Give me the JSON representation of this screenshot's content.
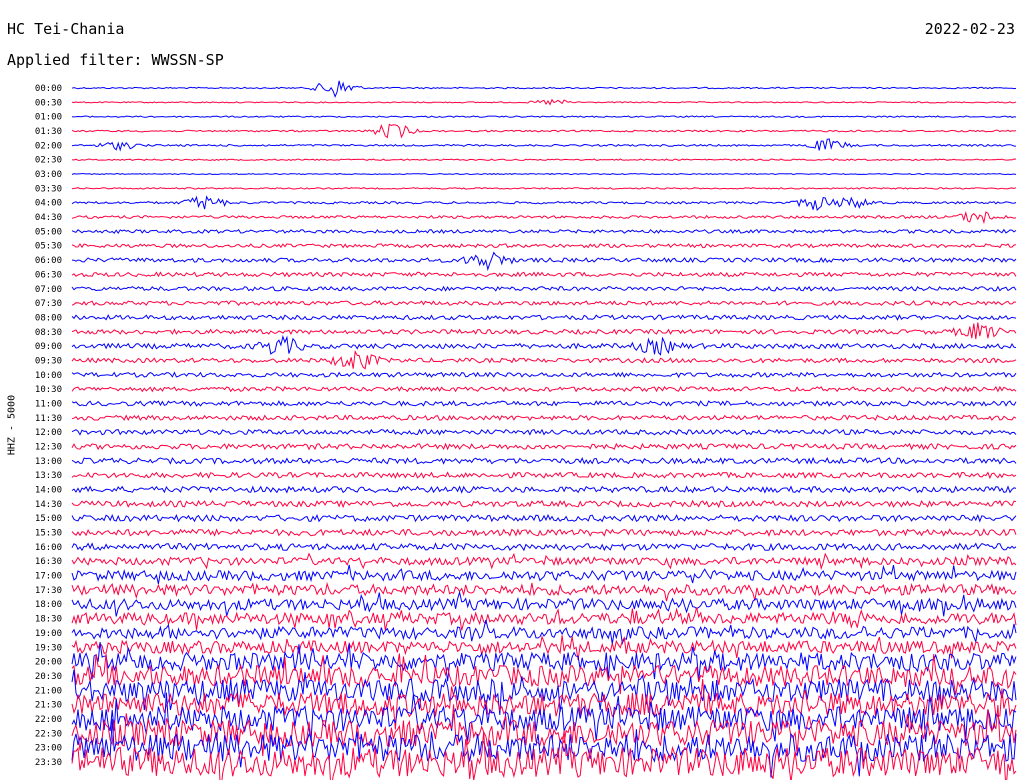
{
  "header": {
    "station": "HC Tei-Chania",
    "filter": "Applied filter: WWSSN-SP",
    "date": "2022-02-23"
  },
  "chart_data": {
    "type": "line",
    "title": "HC Tei-Chania",
    "subtitle": "Applied filter: WWSSN-SP",
    "date": "2022-02-23",
    "ylabel": "HHZ - 5000",
    "xlabel": "",
    "trace_interval_minutes": 30,
    "colors": [
      "#0000ff",
      "#ff0040"
    ],
    "grid": false,
    "legend": "none",
    "row_labels": [
      "00:00",
      "00:30",
      "01:00",
      "01:30",
      "02:00",
      "02:30",
      "03:00",
      "03:30",
      "04:00",
      "04:30",
      "05:00",
      "05:30",
      "06:00",
      "06:30",
      "07:00",
      "07:30",
      "08:00",
      "08:30",
      "09:00",
      "09:30",
      "10:00",
      "10:30",
      "11:00",
      "11:30",
      "12:00",
      "12:30",
      "13:00",
      "13:30",
      "14:00",
      "14:30",
      "15:00",
      "15:30",
      "16:00",
      "16:30",
      "17:00",
      "17:30",
      "18:00",
      "18:30",
      "19:00",
      "19:30",
      "20:00",
      "20:30",
      "21:00",
      "21:30",
      "22:00",
      "22:30",
      "23:00",
      "23:30"
    ],
    "relative_noise_level": [
      0.1,
      0.08,
      0.1,
      0.12,
      0.13,
      0.1,
      0.07,
      0.1,
      0.16,
      0.2,
      0.24,
      0.26,
      0.3,
      0.3,
      0.3,
      0.3,
      0.32,
      0.32,
      0.36,
      0.32,
      0.32,
      0.32,
      0.34,
      0.34,
      0.36,
      0.38,
      0.4,
      0.38,
      0.42,
      0.42,
      0.45,
      0.45,
      0.48,
      0.55,
      0.7,
      0.75,
      0.8,
      0.82,
      0.85,
      0.9,
      1.3,
      1.5,
      1.6,
      1.7,
      1.8,
      1.9,
      2.0,
      2.1
    ],
    "events": [
      {
        "time": "00:00",
        "position": 0.28,
        "amplitude": 10
      },
      {
        "time": "00:30",
        "position": 0.51,
        "amplitude": 3
      },
      {
        "time": "01:30",
        "position": 0.34,
        "amplitude": 8
      },
      {
        "time": "02:00",
        "position": 0.8,
        "amplitude": 6
      },
      {
        "time": "02:00",
        "position": 0.05,
        "amplitude": 4
      },
      {
        "time": "04:00",
        "position": 0.14,
        "amplitude": 7
      },
      {
        "time": "04:00",
        "position": 0.79,
        "amplitude": 7
      },
      {
        "time": "04:00",
        "position": 0.83,
        "amplitude": 5
      },
      {
        "time": "04:30",
        "position": 0.96,
        "amplitude": 6
      },
      {
        "time": "06:00",
        "position": 0.44,
        "amplitude": 9
      },
      {
        "time": "08:30",
        "position": 0.96,
        "amplitude": 8
      },
      {
        "time": "09:00",
        "position": 0.22,
        "amplitude": 9
      },
      {
        "time": "09:00",
        "position": 0.62,
        "amplitude": 7
      },
      {
        "time": "09:30",
        "position": 0.3,
        "amplitude": 10
      }
    ]
  }
}
